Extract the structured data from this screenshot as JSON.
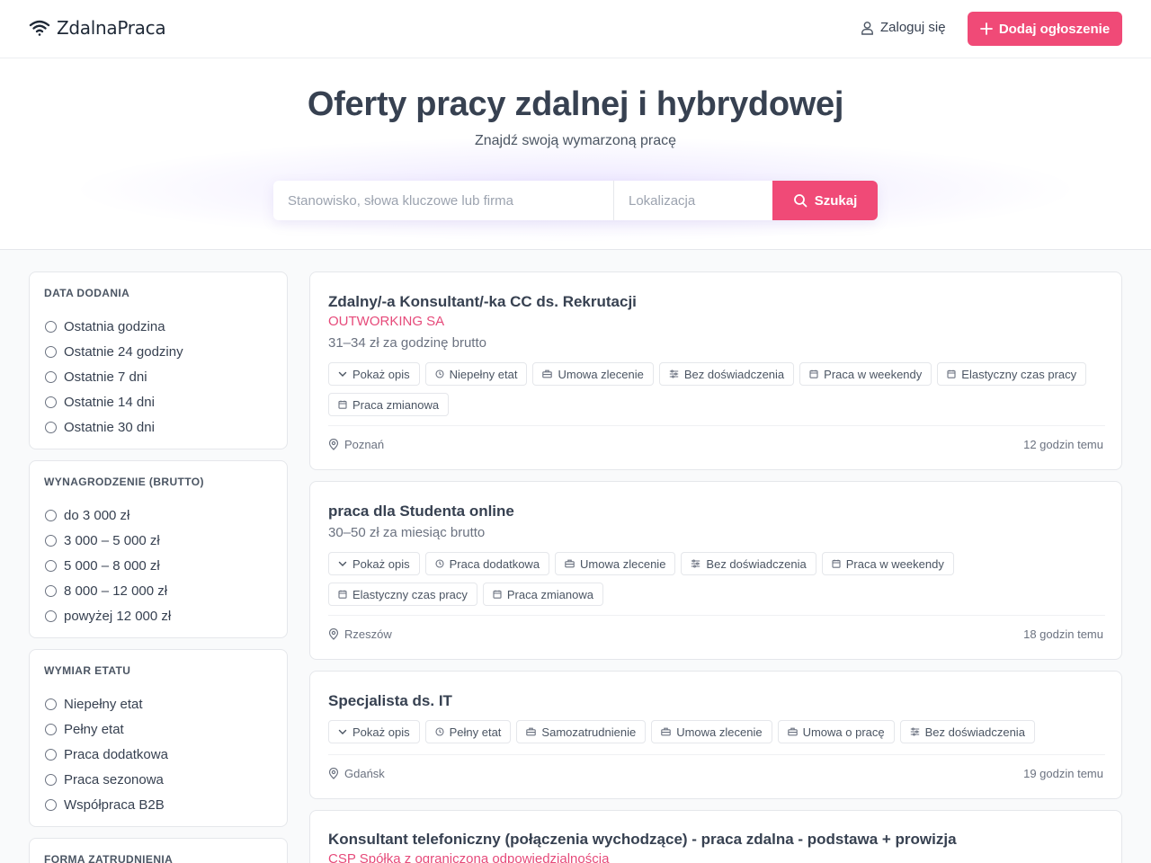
{
  "header": {
    "logo_text": "ZdalnaPraca",
    "login_label": "Zaloguj się",
    "add_button_label": "Dodaj ogłoszenie",
    "accent_color": "#f04a77"
  },
  "hero": {
    "title": "Oferty pracy zdalnej i hybrydowej",
    "subtitle": "Znajdź swoją wymarzoną pracę",
    "search": {
      "keyword_placeholder": "Stanowisko, słowa kluczowe lub firma",
      "keyword_value": "",
      "location_placeholder": "Lokalizacja",
      "location_value": "",
      "button_label": "Szukaj"
    }
  },
  "filters": [
    {
      "title": "DATA DODANIA",
      "options": [
        "Ostatnia godzina",
        "Ostatnie 24 godziny",
        "Ostatnie 7 dni",
        "Ostatnie 14 dni",
        "Ostatnie 30 dni"
      ]
    },
    {
      "title": "WYNAGRODZENIE (BRUTTO)",
      "options": [
        "do 3 000 zł",
        "3 000 – 5 000 zł",
        "5 000 – 8 000 zł",
        "8 000 – 12 000 zł",
        "powyżej 12 000 zł"
      ]
    },
    {
      "title": "WYMIAR ETATU",
      "options": [
        "Niepełny etat",
        "Pełny etat",
        "Praca dodatkowa",
        "Praca sezonowa",
        "Współpraca B2B"
      ]
    },
    {
      "title": "FORMA ZATRUDNIENIA",
      "options": []
    }
  ],
  "jobs": [
    {
      "title": "Zdalny/-a Konsultant/-ka CC ds. Rekrutacji",
      "company": "OUTWORKING SA",
      "salary": "31–34 zł za godzinę brutto",
      "show_description_label": "Pokaż opis",
      "tags": [
        {
          "icon": "clock-icon",
          "label": "Niepełny etat"
        },
        {
          "icon": "briefcase-icon",
          "label": "Umowa zlecenie"
        },
        {
          "icon": "sliders-icon",
          "label": "Bez doświadczenia"
        },
        {
          "icon": "calendar-icon",
          "label": "Praca w weekendy"
        },
        {
          "icon": "calendar-icon",
          "label": "Elastyczny czas pracy"
        },
        {
          "icon": "calendar-icon",
          "label": "Praca zmianowa"
        }
      ],
      "location": "Poznań",
      "posted": "12 godzin temu"
    },
    {
      "title": "praca dla Studenta online",
      "company": "",
      "salary": "30–50 zł za miesiąc brutto",
      "show_description_label": "Pokaż opis",
      "tags": [
        {
          "icon": "clock-icon",
          "label": "Praca dodatkowa"
        },
        {
          "icon": "briefcase-icon",
          "label": "Umowa zlecenie"
        },
        {
          "icon": "sliders-icon",
          "label": "Bez doświadczenia"
        },
        {
          "icon": "calendar-icon",
          "label": "Praca w weekendy"
        },
        {
          "icon": "calendar-icon",
          "label": "Elastyczny czas pracy"
        },
        {
          "icon": "calendar-icon",
          "label": "Praca zmianowa"
        }
      ],
      "location": "Rzeszów",
      "posted": "18 godzin temu"
    },
    {
      "title": "Specjalista ds. IT",
      "company": "",
      "salary": "",
      "show_description_label": "Pokaż opis",
      "tags": [
        {
          "icon": "clock-icon",
          "label": "Pełny etat"
        },
        {
          "icon": "briefcase-icon",
          "label": "Samozatrudnienie"
        },
        {
          "icon": "briefcase-icon",
          "label": "Umowa zlecenie"
        },
        {
          "icon": "briefcase-icon",
          "label": "Umowa o pracę"
        },
        {
          "icon": "sliders-icon",
          "label": "Bez doświadczenia"
        }
      ],
      "location": "Gdańsk",
      "posted": "19 godzin temu"
    },
    {
      "title": "Konsultant telefoniczny (połączenia wychodzące) - praca zdalna - podstawa + prowizja",
      "company": "CSP Spółka z ograniczoną odpowiedzialnością",
      "salary": "",
      "show_description_label": "",
      "tags": [],
      "location": "",
      "posted": ""
    }
  ]
}
